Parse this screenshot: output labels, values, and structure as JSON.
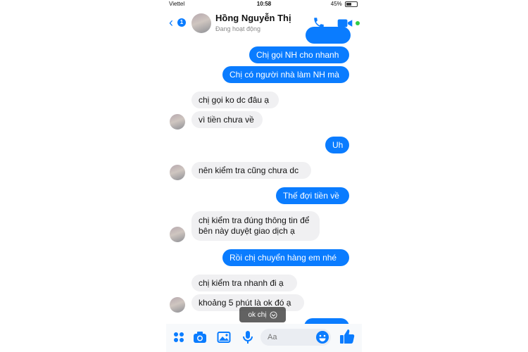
{
  "status_bar": {
    "carrier": "Viettel",
    "time": "10:58",
    "battery": "45%",
    "battery_level": 0.45
  },
  "header": {
    "back_badge": "1",
    "contact_name": "Hồng Nguyễn Thị",
    "presence": "Đang hoạt động"
  },
  "messages": [
    {
      "from": "me",
      "text": "Chị gọi NH cho nhanh"
    },
    {
      "from": "me",
      "text": "Chị có người nhà làm NH mà"
    },
    {
      "from": "them",
      "text": "chị gọi ko dc đâu ạ"
    },
    {
      "from": "them",
      "text": "vì tiền chưa về"
    },
    {
      "from": "me",
      "text": "Uh"
    },
    {
      "from": "them",
      "text": "nên kiểm tra cũng chưa dc"
    },
    {
      "from": "me",
      "text": "Thế đợi tiền về"
    },
    {
      "from": "them",
      "text": "chị kiểm tra đúng thông tin để bên này duyệt giao dịch ạ"
    },
    {
      "from": "me",
      "text": "Rồi chị chuyển hàng em nhé"
    },
    {
      "from": "them",
      "text": "chị kiểm tra nhanh  đi ạ"
    },
    {
      "from": "them",
      "text": "khoảng 5 phút là ok đó ạ"
    }
  ],
  "toast": {
    "text": "ok chị"
  },
  "composer": {
    "placeholder": "Aa",
    "icons": [
      "apps-icon",
      "camera-icon",
      "gallery-icon",
      "microphone-icon",
      "emoji-icon",
      "thumbs-up-icon"
    ]
  },
  "colors": {
    "accent": "#0a7cff",
    "incoming_bubble": "#f0f0f2",
    "online": "#31cc46"
  }
}
